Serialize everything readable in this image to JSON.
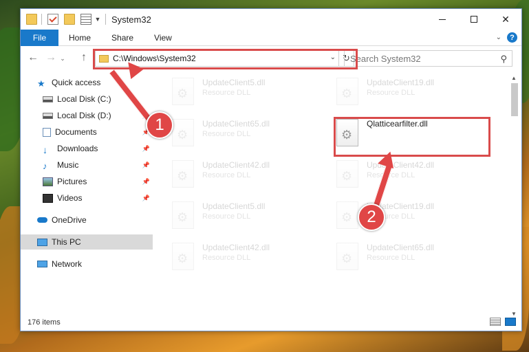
{
  "window": {
    "title": "System32"
  },
  "ribbon": {
    "tabs": [
      "File",
      "Home",
      "Share",
      "View"
    ],
    "help": "?"
  },
  "nav": {
    "back": "←",
    "forward": "→",
    "up": "↑",
    "address": "C:\\Windows\\System32",
    "dropdown": "⌄",
    "refresh": "↻",
    "search_placeholder": "Search System32",
    "search_icon": "⚲"
  },
  "sidebar": {
    "items": [
      {
        "label": "Quick access",
        "icon": "star-icon",
        "pinned": false
      },
      {
        "label": "Local Disk (C:)",
        "icon": "drive-icon",
        "pinned": false
      },
      {
        "label": "Local Disk (D:)",
        "icon": "drive-icon",
        "pinned": true
      },
      {
        "label": "Documents",
        "icon": "documents-icon",
        "pinned": true
      },
      {
        "label": "Downloads",
        "icon": "downloads-icon",
        "pinned": true
      },
      {
        "label": "Music",
        "icon": "music-icon",
        "pinned": true
      },
      {
        "label": "Pictures",
        "icon": "pictures-icon",
        "pinned": true
      },
      {
        "label": "Videos",
        "icon": "videos-icon",
        "pinned": true
      },
      {
        "label": "OneDrive",
        "icon": "cloud-icon",
        "pinned": false
      },
      {
        "label": "This PC",
        "icon": "computer-icon",
        "pinned": false,
        "selected": true
      },
      {
        "label": "Network",
        "icon": "network-icon",
        "pinned": false
      }
    ]
  },
  "files": {
    "type_label": "Resource DLL",
    "left": [
      "UpdateClient5.dll",
      "UpdateClient65.dll",
      "UpdateClient42.dll",
      "UpdateClient5.dll",
      "UpdateClient42.dll"
    ],
    "right": [
      "UpdateClient19.dll",
      "Qlatticearfilter.dll",
      "UpdateClient42.dll",
      "UpdateClient19.dll",
      "UpdateClient65.dll"
    ],
    "highlighted": "Qlatticearfilter.dll"
  },
  "status": {
    "count": "176 items"
  },
  "annotations": {
    "step1": "1",
    "step2": "2"
  },
  "colors": {
    "accent": "#1979ca",
    "annotation": "#e04646",
    "highlight_border": "#d94b4b"
  }
}
